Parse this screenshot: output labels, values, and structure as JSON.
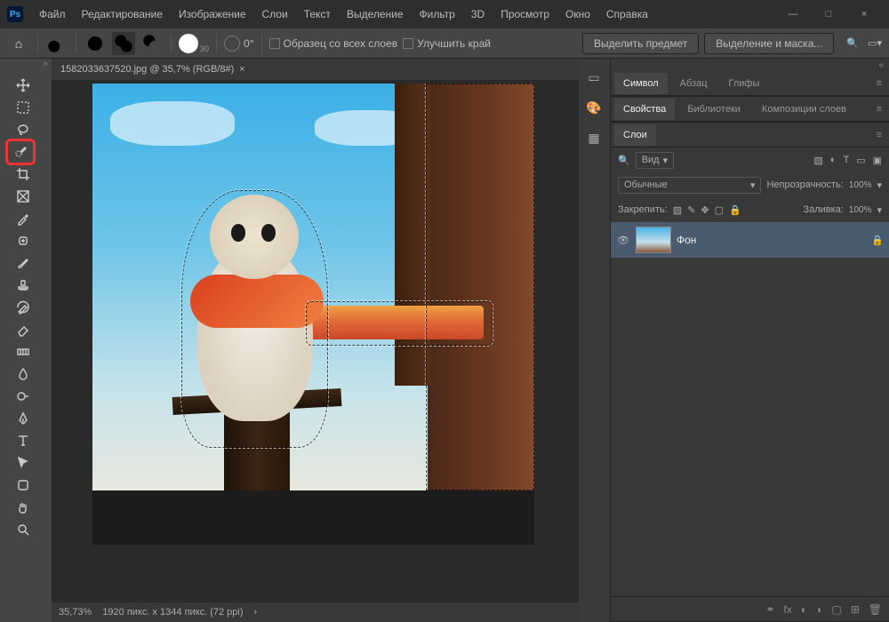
{
  "app": {
    "logo": "Ps"
  },
  "menu": [
    "Файл",
    "Редактирование",
    "Изображение",
    "Слои",
    "Текст",
    "Выделение",
    "Фильтр",
    "3D",
    "Просмотр",
    "Окно",
    "Справка"
  ],
  "options": {
    "brush_size": "30",
    "angle": "0°",
    "sample_all": "Образец со всех слоев",
    "refine_edge": "Улучшить край",
    "select_subject": "Выделить предмет",
    "select_mask": "Выделение и маска..."
  },
  "document": {
    "tab": "1582033637520.jpg @ 35,7% (RGB/8#)",
    "close": "×"
  },
  "status": {
    "zoom": "35,73%",
    "dims": "1920 пикс. x 1344 пикс. (72 ppi)",
    "arrow": "›"
  },
  "panels": {
    "char_tabs": [
      "Символ",
      "Абзац",
      "Глифы"
    ],
    "prop_tabs": [
      "Свойства",
      "Библиотеки",
      "Композиции слоев"
    ],
    "layers_tab": "Слои",
    "search_label": "Вид",
    "blend": "Обычные",
    "opacity_label": "Непрозрачность:",
    "opacity": "100%",
    "lock_label": "Закрепить:",
    "fill_label": "Заливка:",
    "fill": "100%",
    "layer_name": "Фон"
  }
}
